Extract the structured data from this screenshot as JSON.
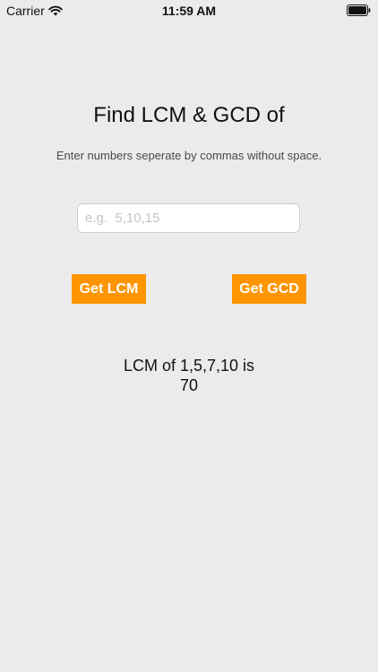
{
  "status_bar": {
    "carrier": "Carrier",
    "time": "11:59 AM",
    "icons": [
      "wifi-icon",
      "battery-icon"
    ]
  },
  "main": {
    "title": "Find LCM & GCD of",
    "instructions": "Enter numbers seperate by commas without space.",
    "input": {
      "value": "",
      "placeholder": "e.g.  5,10,15"
    },
    "buttons": {
      "lcm_label": "Get LCM",
      "gcd_label": "Get GCD"
    },
    "result": {
      "line1": "LCM of 1,5,7,10 is",
      "line2": "70"
    }
  },
  "colors": {
    "background": "#ebebeb",
    "accent": "#ff9500",
    "button_text": "#ffffff"
  }
}
